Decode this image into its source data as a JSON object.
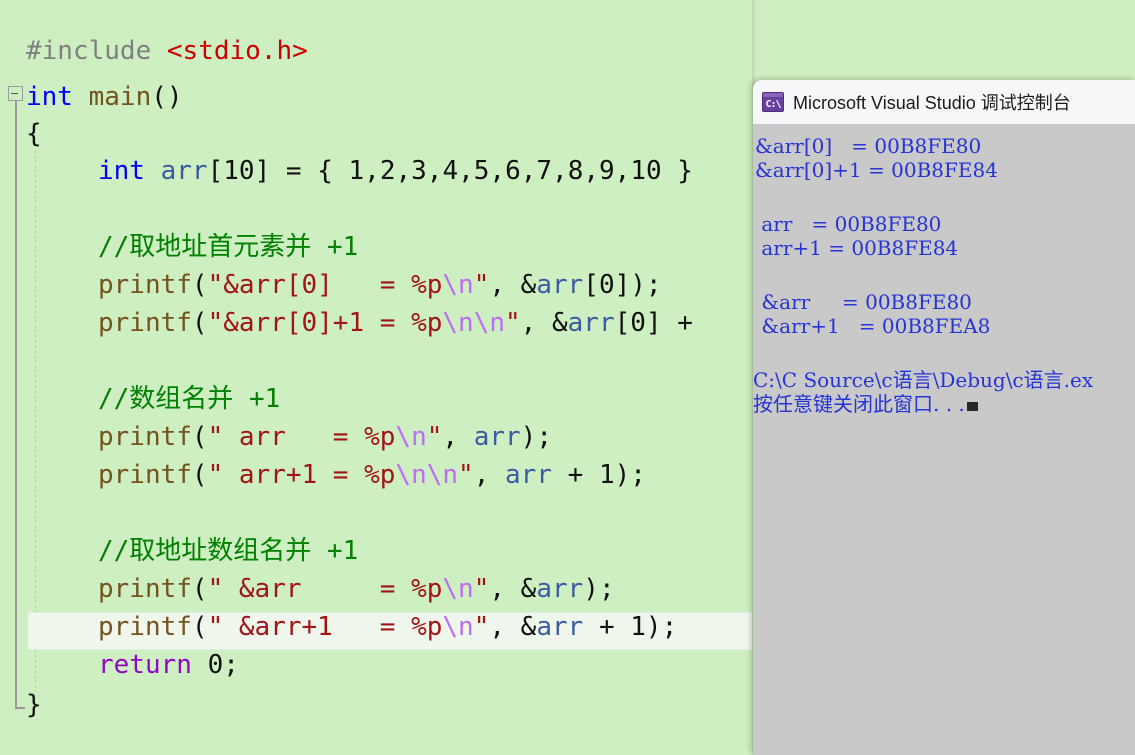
{
  "editor": {
    "background_color": "#CEEFC1",
    "current_line_color": "#EFF6EC",
    "language": "c",
    "lines": [
      {
        "n": 1,
        "indent": 0,
        "text": "#include <stdio.h>"
      },
      {
        "n": 2,
        "indent": 0,
        "text": "int main()"
      },
      {
        "n": 3,
        "indent": 0,
        "text": "{"
      },
      {
        "n": 4,
        "indent": 1,
        "text": "int arr[10] = { 1,2,3,4,5,6,7,8,9,10 }"
      },
      {
        "n": 5,
        "indent": 1,
        "text": ""
      },
      {
        "n": 6,
        "indent": 1,
        "text": "//取地址首元素并 +1"
      },
      {
        "n": 7,
        "indent": 1,
        "text": "printf(\"&arr[0]   = %p\\n\", &arr[0]);"
      },
      {
        "n": 8,
        "indent": 1,
        "text": "printf(\"&arr[0]+1 = %p\\n\\n\", &arr[0] +"
      },
      {
        "n": 9,
        "indent": 1,
        "text": ""
      },
      {
        "n": 10,
        "indent": 1,
        "text": "//数组名并 +1"
      },
      {
        "n": 11,
        "indent": 1,
        "text": "printf(\" arr   = %p\\n\", arr);"
      },
      {
        "n": 12,
        "indent": 1,
        "text": "printf(\" arr+1 = %p\\n\\n\", arr + 1);"
      },
      {
        "n": 13,
        "indent": 1,
        "text": ""
      },
      {
        "n": 14,
        "indent": 1,
        "text": "//取地址数组名并 +1"
      },
      {
        "n": 15,
        "indent": 1,
        "text": "printf(\" &arr     = %p\\n\", &arr);"
      },
      {
        "n": 16,
        "indent": 1,
        "text": "printf(\" &arr+1   = %p\\n\", &arr + 1);",
        "current": true
      },
      {
        "n": 17,
        "indent": 1,
        "text": "return 0;"
      },
      {
        "n": 18,
        "indent": 0,
        "text": "}"
      }
    ],
    "outline": {
      "collapse_toggle_state": "expanded",
      "collapse_toggle_glyph": "−"
    }
  },
  "console": {
    "icon_name": "console-app-icon",
    "icon_glyph": "C:\\",
    "title": "Microsoft Visual Studio 调试控制台",
    "text_color": "#2633D6",
    "background_color": "#C9C9C9",
    "output_lines": [
      "&arr[0]   = 00B8FE80",
      "&arr[0]+1 = 00B8FE84",
      "",
      " arr   = 00B8FE80",
      " arr+1 = 00B8FE84",
      "",
      " &arr     = 00B8FE80",
      " &arr+1   = 00B8FEA8",
      "",
      "C:\\C Source\\c语言\\Debug\\c语言.ex",
      "按任意键关闭此窗口. . ."
    ],
    "values": {
      "addr_arr0": "00B8FE80",
      "addr_arr0_plus1": "00B8FE84",
      "addr_arr": "00B8FE80",
      "addr_arr_plus1": "00B8FE84",
      "addr_amp_arr": "00B8FE80",
      "addr_amp_arr_plus1": "00B8FEA8"
    },
    "exe_path": "C:\\C Source\\c语言\\Debug\\c语言.ex",
    "prompt": "按任意键关闭此窗口. . ."
  }
}
